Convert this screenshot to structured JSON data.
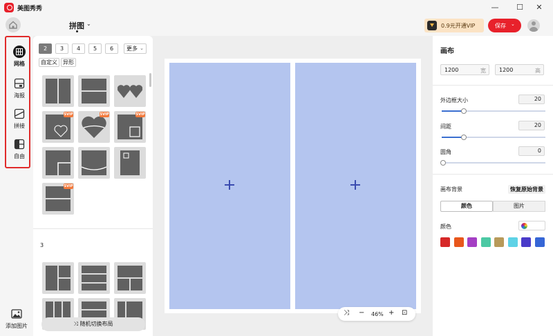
{
  "app": {
    "title": "美图秀秀",
    "mode": "拼图"
  },
  "toolbar": {
    "vip_label": "0.9元开通VIP",
    "save_label": "保存"
  },
  "nav": {
    "items": [
      {
        "label": "网格",
        "icon": "grid-icon",
        "active": true
      },
      {
        "label": "海报",
        "icon": "poster-icon",
        "active": false
      },
      {
        "label": "拼接",
        "icon": "stitch-icon",
        "active": false
      },
      {
        "label": "自由",
        "icon": "freestyle-icon",
        "active": false
      }
    ],
    "add_photo": "添加图片"
  },
  "layout_panel": {
    "count_tabs": [
      "2",
      "3",
      "4",
      "5",
      "6"
    ],
    "active_count": "2",
    "more_label": "更多",
    "sub_tabs": [
      "自定义",
      "异形"
    ],
    "svip_badge": "SVIP",
    "section_3_label": "3",
    "shuffle_label": "随机切换布局"
  },
  "canvas": {
    "zoom": "46%"
  },
  "props": {
    "title": "画布",
    "width": {
      "value": "1200",
      "unit": "宽"
    },
    "height": {
      "value": "1200",
      "unit": "高"
    },
    "outer_border": {
      "label": "外边框大小",
      "value": "20",
      "level": 0.2
    },
    "spacing": {
      "label": "间距",
      "value": "20",
      "level": 0.2
    },
    "corner": {
      "label": "圆角",
      "value": "0",
      "level": 0
    },
    "background": {
      "label": "画布背景",
      "restore": "恢复原始背景",
      "tabs": [
        "颜色",
        "图片"
      ],
      "color_label": "颜色",
      "swatches": [
        "#d62828",
        "#e8571c",
        "#a53fc4",
        "#4cc9a4",
        "#b89a5a",
        "#5ed2e6",
        "#4a3bc9",
        "#3666d6"
      ]
    }
  },
  "colors": {
    "accent": "#e8212b",
    "cell": "#b4c5ef",
    "highlight_border": "#e02a2a"
  }
}
